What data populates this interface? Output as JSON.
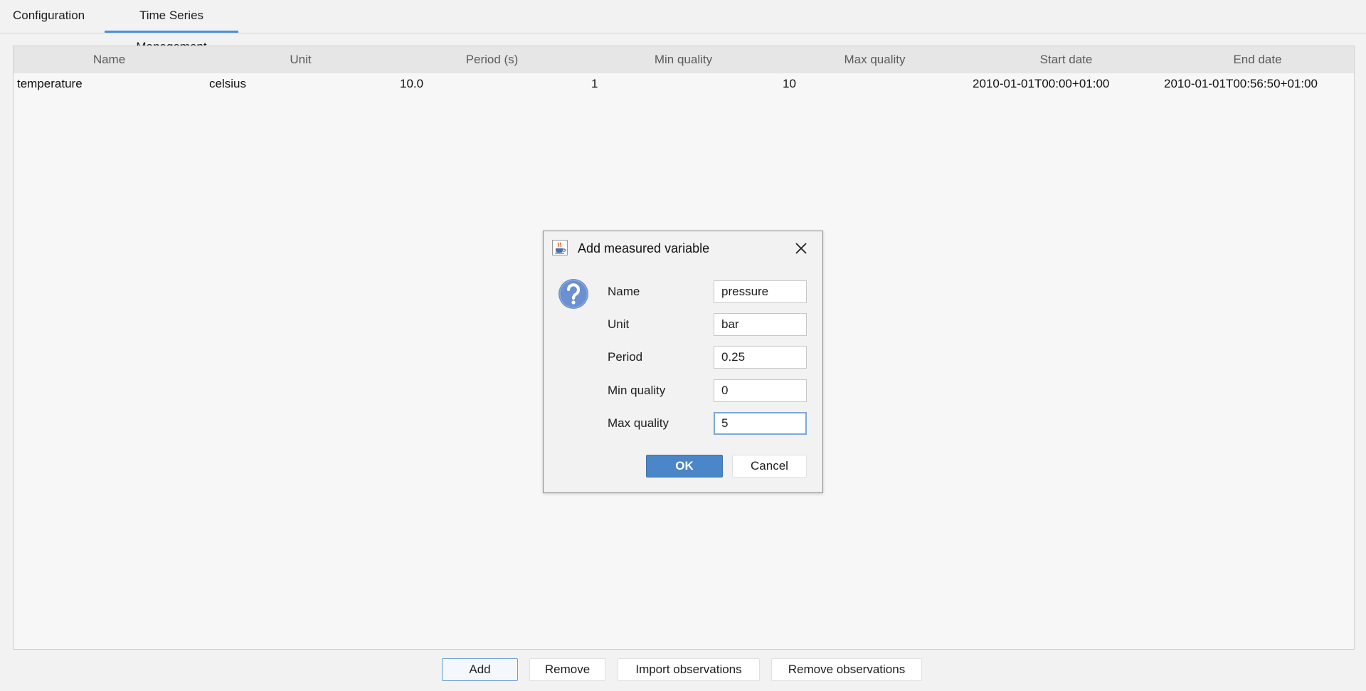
{
  "tabs": [
    {
      "label": "Configuration"
    },
    {
      "label": "Time Series Management"
    }
  ],
  "table": {
    "columns": [
      "Name",
      "Unit",
      "Period (s)",
      "Min quality",
      "Max quality",
      "Start date",
      "End date"
    ],
    "rows": [
      [
        "temperature",
        "celsius",
        "10.0",
        "1",
        "10",
        "2010-01-01T00:00+01:00",
        "2010-01-01T00:56:50+01:00"
      ]
    ]
  },
  "buttons": {
    "add": "Add",
    "remove": "Remove",
    "import_observations": "Import observations",
    "remove_observations": "Remove observations"
  },
  "dialog": {
    "title": "Add measured variable",
    "fields": [
      {
        "label": "Name",
        "value": "pressure"
      },
      {
        "label": "Unit",
        "value": "bar"
      },
      {
        "label": "Period",
        "value": "0.25"
      },
      {
        "label": "Min quality",
        "value": "0"
      },
      {
        "label": "Max quality",
        "value": "5"
      }
    ],
    "ok": "OK",
    "cancel": "Cancel"
  },
  "colors": {
    "accent": "#4a90d9",
    "ok_button": "#4a86c8",
    "question_icon": "#6b8fd0"
  },
  "icons": {
    "dialog_app": "java-cup-icon",
    "close": "close-icon",
    "question": "question-icon"
  }
}
